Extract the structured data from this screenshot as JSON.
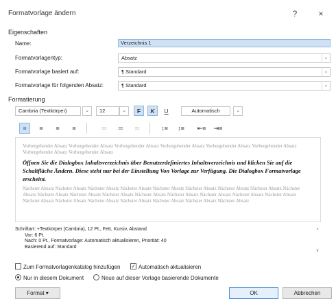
{
  "window": {
    "title": "Formatvorlage ändern",
    "help_label": "?",
    "close_label": "×"
  },
  "properties": {
    "heading": "Eigenschaften",
    "rows": [
      {
        "label": "Name:",
        "value": "Verzeichnis 1"
      },
      {
        "label": "Formatvorlagentyp:",
        "value": "Absatz"
      },
      {
        "label": "Formatvorlage basiert auf:",
        "value": "¶ Standard"
      },
      {
        "label": "Formatvorlage für folgenden Absatz:",
        "value": "¶ Standard"
      }
    ]
  },
  "formatting": {
    "heading": "Formatierung",
    "font": "Cambria (Textkörper)",
    "size": "12",
    "bold": "F",
    "italic": "K",
    "underline": "U",
    "color": "Automatisch",
    "align_buttons": [
      {
        "glyph": "≡",
        "state": "active"
      },
      {
        "glyph": "≡",
        "state": "normal"
      },
      {
        "glyph": "≡",
        "state": "normal"
      },
      {
        "glyph": "≡",
        "state": "normal"
      },
      {
        "glyph": "═",
        "state": "disabled"
      },
      {
        "glyph": "═",
        "state": "normal"
      },
      {
        "glyph": "═",
        "state": "disabled"
      },
      {
        "glyph": "↕≡",
        "state": "normal"
      },
      {
        "glyph": "↕≡",
        "state": "normal"
      },
      {
        "glyph": "⇤≡",
        "state": "normal"
      },
      {
        "glyph": "⇥≡",
        "state": "normal"
      }
    ]
  },
  "preview": {
    "prev_text": "Vorhergehender Absatz Vorhergehender Absatz Vorhergehender Absatz Vorhergehender Absatz Vorhergehender Absatz Vorhergehender Absatz Vorhergehender Absatz Vorhergehender Absatz",
    "current_text": "Öffnen Sie die Dialogbox Inhaltsverzeichnis über Benutzerdefiniertes Inhaltsverzeichnis und klicken Sie auf die Schaltfläche Ändern. Diese steht nur bei der Einstellung Von Vorlage zur Verfügung. Die Dialogbox Formatvorlage erscheint.",
    "next_text": "Nächster Absatz Nächster Absatz Nächster Absatz Nächster Absatz Nächster Absatz Nächster Absatz Nächster Absatz Nächster Absatz Nächster Absatz Nächster Absatz Nächster Absatz Nächster Absatz Nächster Absatz Nächster Absatz Nächster Absatz Nächster Absatz Nächster Absatz Nächster Absatz Nächster Absatz Nächster Absatz Nächster Absatz Nächster Absatz Nächster Absatz Nächster Absatz"
  },
  "description": {
    "lines": [
      "Schriftart: +Textkörper (Cambria), 12 Pt., Fett, Kursiv, Abstand",
      "Vor: 6 Pt.",
      "Nach: 0 Pt., Formatvorlage: Automatisch aktualisieren, Priorität: 40",
      "Basierend auf: Standard"
    ],
    "scroll_up": "^",
    "scroll_down": "v"
  },
  "options": {
    "add_to_gallery": "Zum Formatvorlagenkatalog hinzufügen",
    "auto_update": "Automatisch aktualisieren",
    "auto_update_checked": "✓",
    "only_this_doc": "Nur in diesem Dokument",
    "new_docs": "Neue auf dieser Vorlage basierende Dokumente"
  },
  "buttons": {
    "format": "Format ▾",
    "ok": "OK",
    "cancel": "Abbrechen"
  }
}
